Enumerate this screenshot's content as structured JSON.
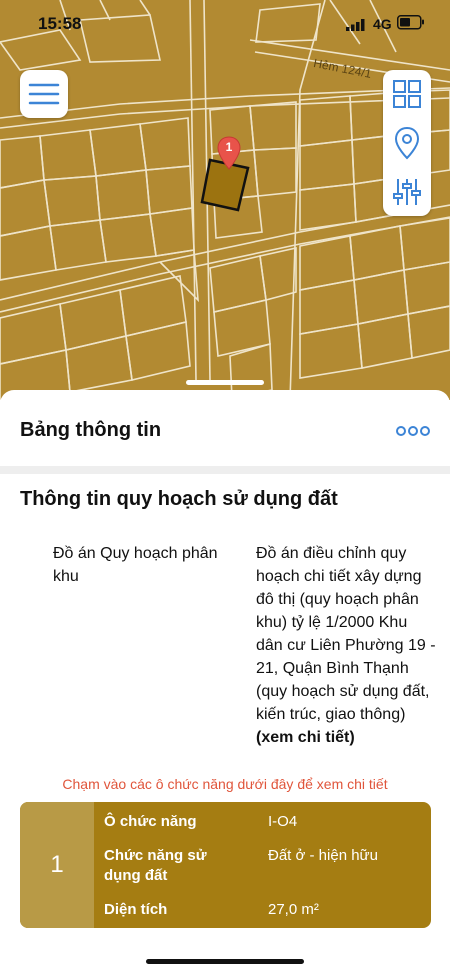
{
  "status_bar": {
    "time": "15:58",
    "network": "4G"
  },
  "map": {
    "street_label": "Hẻm 124/1",
    "marker_number": "1",
    "parcel_color": "#b28a32",
    "highlight_color": "#9c7310"
  },
  "sheet": {
    "title": "Bảng thông tin",
    "section_title": "Thông tin quy hoạch sử dụng đất",
    "project_label": "Đồ án Quy hoạch phân khu",
    "project_value": "Đồ án điều chỉnh quy hoạch chi tiết xây dựng đô thị (quy hoạch phân khu) tỷ lệ 1/2000  Khu dân cư Liên Phường 19 - 21, Quận Bình Thạnh (quy hoạch sử dụng đất, kiến trúc, giao thông) ",
    "detail_link": "(xem chi tiết)",
    "hint": "Chạm vào các ô chức năng dưới đây để xem chi tiết"
  },
  "card": {
    "index": "1",
    "rows": [
      {
        "label": "Ô chức năng",
        "value": "I-O4"
      },
      {
        "label": "Chức năng sử dụng đất",
        "value": "Đất ở - hiện hữu"
      },
      {
        "label": "Diện tích",
        "value": "27,0 m²"
      }
    ]
  },
  "colors": {
    "accent": "#3c84d6",
    "hint": "#e0553b",
    "card": "#a57d12",
    "card_index": "#b89a46"
  }
}
